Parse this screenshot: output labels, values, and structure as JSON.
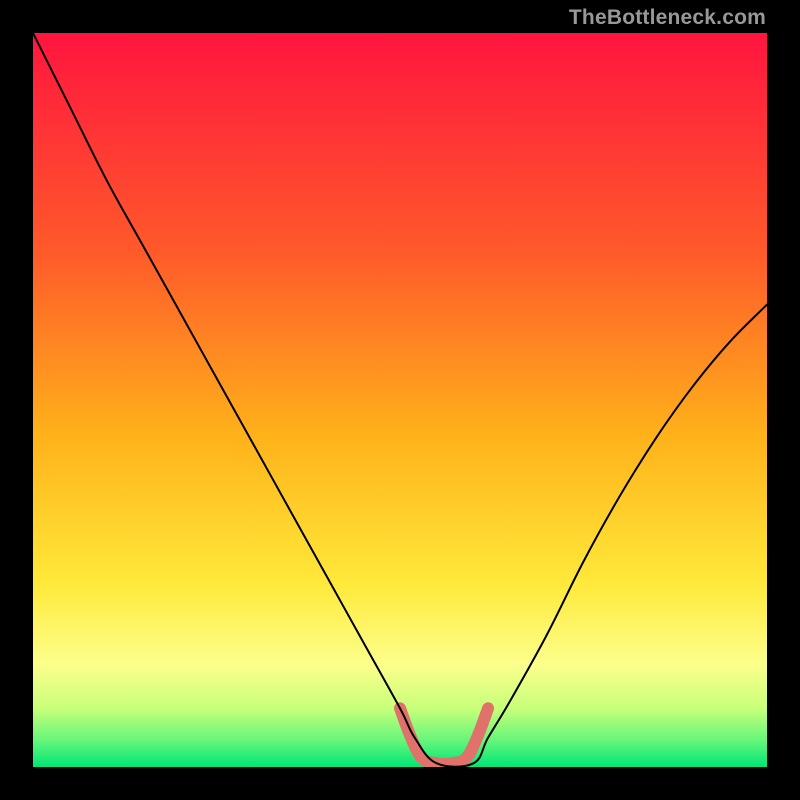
{
  "watermark": "TheBottleneck.com",
  "chart_data": {
    "type": "line",
    "title": "",
    "xlabel": "",
    "ylabel": "",
    "xlim": [
      0,
      100
    ],
    "ylim": [
      0,
      100
    ],
    "grid": false,
    "gradient_stops": [
      {
        "offset": 0.0,
        "color": "#ff153f"
      },
      {
        "offset": 0.3,
        "color": "#ff5a2a"
      },
      {
        "offset": 0.55,
        "color": "#ffb21a"
      },
      {
        "offset": 0.75,
        "color": "#ffe93a"
      },
      {
        "offset": 0.86,
        "color": "#fcff8c"
      },
      {
        "offset": 0.92,
        "color": "#c8ff7a"
      },
      {
        "offset": 0.965,
        "color": "#63f57a"
      },
      {
        "offset": 1.0,
        "color": "#00e676"
      }
    ],
    "series": [
      {
        "name": "bottleneck-curve",
        "color": "#000000",
        "stroke_width": 2,
        "x": [
          0,
          5,
          10,
          15,
          20,
          25,
          30,
          35,
          40,
          45,
          50,
          52,
          55,
          60,
          62,
          65,
          70,
          75,
          80,
          85,
          90,
          95,
          100
        ],
        "y": [
          100,
          90,
          80,
          71,
          62,
          53,
          44,
          35,
          26,
          17,
          8,
          4,
          0.5,
          0.5,
          4,
          9,
          18,
          28,
          37,
          45,
          52,
          58,
          63
        ]
      },
      {
        "name": "highlight-band",
        "color": "#e0726b",
        "stroke_width": 12,
        "x": [
          50,
          51.5,
          53,
          55,
          57,
          59,
          60.5,
          62
        ],
        "y": [
          8,
          4,
          1.2,
          0.5,
          0.5,
          1.2,
          4,
          8
        ]
      }
    ]
  }
}
